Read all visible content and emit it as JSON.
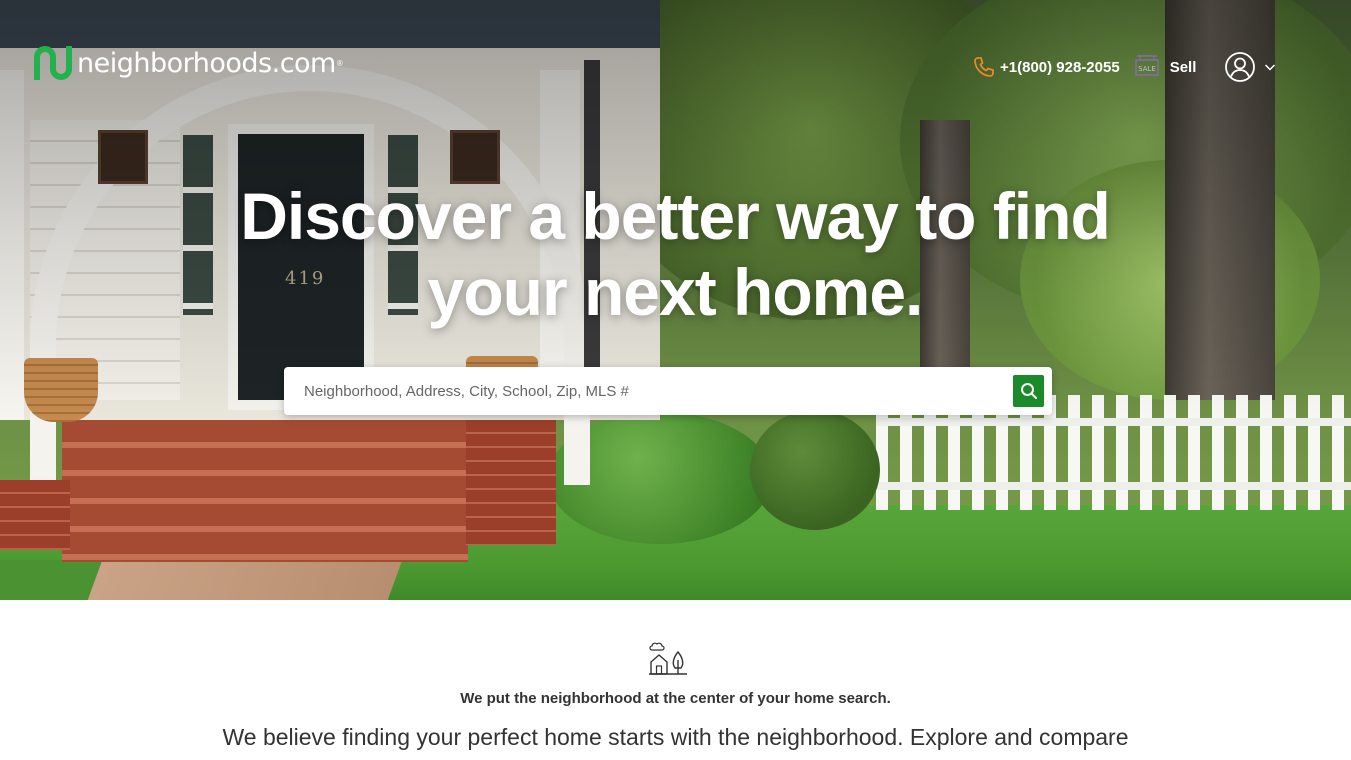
{
  "brand": {
    "name": "neighborhoods.com",
    "registered_mark": "®",
    "accent_color": "#1a8a2a",
    "logo_icon": "neighborhoods-logo-icon"
  },
  "nav": {
    "phone_icon": "phone-icon",
    "phone": "+1(800) 928-2055",
    "sell_icon": "sale-sign-icon",
    "sell_icon_text": "SALE",
    "sell": "Sell",
    "account_icon": "user-circle-icon",
    "account_menu_icon": "chevron-down-icon"
  },
  "hero": {
    "house_number": "419",
    "headline": "Discover a better way to find your next home."
  },
  "search": {
    "placeholder": "Neighborhood, Address, City, School, Zip, MLS #",
    "value": "",
    "button_icon": "search-icon"
  },
  "about": {
    "icon": "house-and-tree-icon",
    "heading": "We put the neighborhood at the center of your home search.",
    "body": "We believe finding your perfect home starts with the neighborhood. Explore and compare"
  }
}
